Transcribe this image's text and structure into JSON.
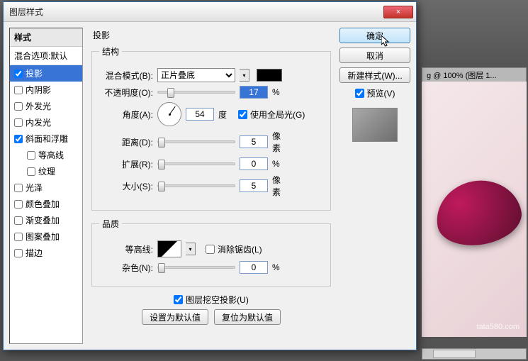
{
  "bg": {
    "tab_title": "g @ 100% (图层 1...",
    "watermark": "tata580.com"
  },
  "dialog": {
    "title": "图层样式",
    "close": "×"
  },
  "styles_panel": {
    "header": "样式",
    "blend_options": "混合选项:默认",
    "items": [
      {
        "label": "投影",
        "checked": true,
        "selected": true
      },
      {
        "label": "内阴影",
        "checked": false
      },
      {
        "label": "外发光",
        "checked": false
      },
      {
        "label": "内发光",
        "checked": false
      },
      {
        "label": "斜面和浮雕",
        "checked": true
      },
      {
        "label": "等高线",
        "checked": false,
        "sub": true
      },
      {
        "label": "纹理",
        "checked": false,
        "sub": true
      },
      {
        "label": "光泽",
        "checked": false
      },
      {
        "label": "颜色叠加",
        "checked": false
      },
      {
        "label": "渐变叠加",
        "checked": false
      },
      {
        "label": "图案叠加",
        "checked": false
      },
      {
        "label": "描边",
        "checked": false
      }
    ]
  },
  "shadow": {
    "section": "投影",
    "structure_legend": "结构",
    "blend_mode_label": "混合模式(B):",
    "blend_mode_value": "正片叠底",
    "opacity_label": "不透明度(O):",
    "opacity_value": "17",
    "opacity_unit": "%",
    "angle_label": "角度(A):",
    "angle_value": "54",
    "angle_unit": "度",
    "global_light_label": "使用全局光(G)",
    "distance_label": "距离(D):",
    "distance_value": "5",
    "distance_unit": "像素",
    "spread_label": "扩展(R):",
    "spread_value": "0",
    "spread_unit": "%",
    "size_label": "大小(S):",
    "size_value": "5",
    "size_unit": "像素",
    "quality_legend": "品质",
    "contour_label": "等高线:",
    "antialias_label": "消除锯齿(L)",
    "noise_label": "杂色(N):",
    "noise_value": "0",
    "noise_unit": "%",
    "knockout_label": "图层挖空投影(U)",
    "set_default": "设置为默认值",
    "reset_default": "复位为默认值"
  },
  "buttons": {
    "ok": "确定",
    "cancel": "取消",
    "new_style": "新建样式(W)...",
    "preview": "预览(V)"
  }
}
